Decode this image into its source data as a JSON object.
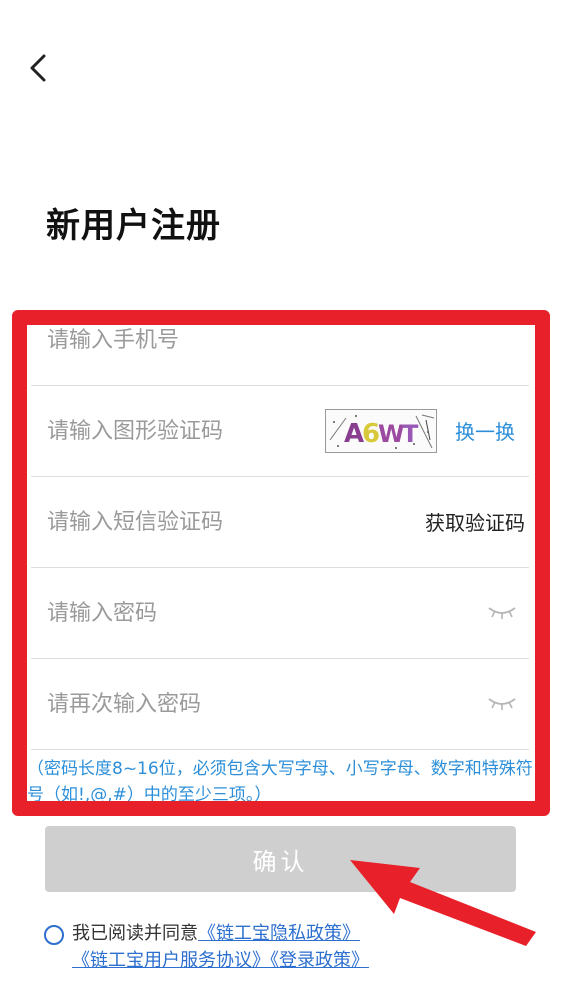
{
  "header": {
    "title": "新用户注册",
    "back_icon": "chevron-left-icon"
  },
  "form": {
    "phone_placeholder": "请输入手机号",
    "captcha_placeholder": "请输入图形验证码",
    "captcha_text": "A6WT",
    "captcha_refresh_label": "换一换",
    "sms_placeholder": "请输入短信验证码",
    "sms_button_label": "获取验证码",
    "password_placeholder": "请输入密码",
    "password_confirm_placeholder": "请再次输入密码",
    "eye_icon": "eye-closed-icon",
    "hint": "（密码长度8~16位，必须包含大写字母、小写字母、数字和特殊符号（如!,@,#）中的至少三项。）"
  },
  "confirm_label": "确认",
  "agreement": {
    "prefix": "我已阅读并同意",
    "privacy_link": "《链工宝隐私政策》",
    "service_link": "《链工宝用户服务协议》",
    "login_link": "《登录政策》"
  },
  "colors": {
    "highlight_frame": "#e8202a",
    "link_blue": "#2d8fd9",
    "button_disabled": "#cfcfcf"
  }
}
